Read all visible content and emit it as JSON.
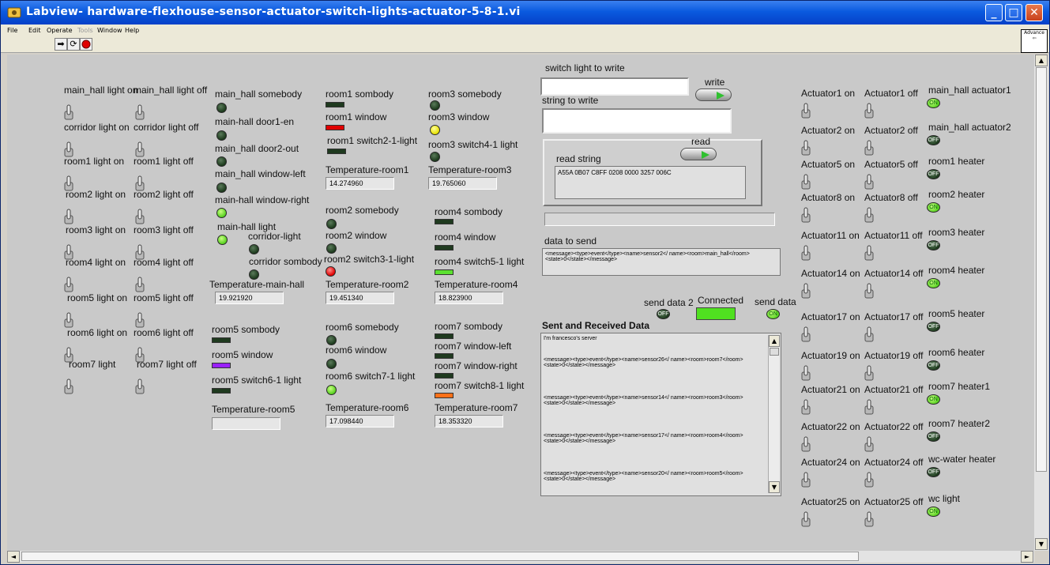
{
  "window": {
    "title": "Labview- hardware-flexhouse-sensor-actuator-switch-lights-actuator-5-8-1.vi"
  },
  "menu": [
    "File",
    "Edit",
    "Operate",
    "Tools",
    "Window",
    "Help"
  ],
  "advanced_label": "Advance",
  "left_switches": [
    [
      "main_hall light on",
      "main_hall light off"
    ],
    [
      "corridor light on",
      "corridor light off"
    ],
    [
      "room1 light on",
      "room1 light off"
    ],
    [
      "room2 light on",
      "room2 light off"
    ],
    [
      "room3 light on",
      "room3 light off"
    ],
    [
      "room4 light on",
      "room4 light off"
    ],
    [
      "room5 light on",
      "room5 light off"
    ],
    [
      "room6 light on",
      "room6 light off"
    ],
    [
      "room7 light",
      "room7 light off"
    ]
  ],
  "mainhall": {
    "somebody": "main_hall somebody",
    "door1": "main-hall door1-en",
    "door2": "main_hall door2-out",
    "window_left": "main_hall window-left",
    "window_right": "main-hall window-right",
    "light": "main-hall light",
    "corridor_light": "corridor-light",
    "corridor_somebody": "corridor sombody",
    "temp_label": "Temperature-main-hall",
    "temp": "19.921920"
  },
  "room1": {
    "somebody": "room1 sombody",
    "window": "room1 window",
    "switch": "room1 switch2-1-light",
    "temp_label": "Temperature-room1",
    "temp": "14.274960"
  },
  "room3": {
    "somebody": "room3 somebody",
    "window": "room3 window",
    "switch": "room3 switch4-1 light",
    "temp_label": "Temperature-room3",
    "temp": "19.765060"
  },
  "room2": {
    "somebody": "room2 somebody",
    "window": "room2 window",
    "switch": "room2 switch3-1-light",
    "temp_label": "Temperature-room2",
    "temp": "19.451340"
  },
  "room4": {
    "somebody": "room4 sombody",
    "window": "room4 window",
    "switch": "room4 switch5-1 light",
    "temp_label": "Temperature-room4",
    "temp": "18.823900"
  },
  "room5": {
    "somebody": "room5 sombody",
    "window": "room5 window",
    "switch": "room5 switch6-1 light",
    "temp_label": "Temperature-room5",
    "temp": ""
  },
  "room6": {
    "somebody": "room6 somebody",
    "window": "room6 window",
    "switch": "room6 switch7-1 light",
    "temp_label": "Temperature-room6",
    "temp": "17.098440"
  },
  "room7": {
    "somebody": "room7 sombody",
    "window_left": "room7 window-left",
    "window_right": "room7 window-right",
    "switch": "room7 switch8-1 light",
    "temp_label": "Temperature-room7",
    "temp": "18.353320"
  },
  "comm": {
    "switch_light_label": "switch light to write",
    "switch_light_value": "",
    "write_label": "write",
    "string_label": "string to write",
    "string_value": "",
    "read_label": "read",
    "read_string_label": "read string",
    "read_string_value": "A55A 0B07 C8FF 0208 0000 3257 006C",
    "data_to_send_label": "data to send",
    "data_to_send_value": "<message><type>event</type><name>sensor2</ name><room>main_hall</room><state>0</state></message>",
    "send_data2_label": "send data 2",
    "connected_label": "Connected",
    "send_data_label": "send data",
    "off_text": "OFF",
    "on_text": "ON",
    "sent_received_label": "Sent and Received Data",
    "log": [
      "I'm francesco's server",
      "<message><type>event</type><name>sensor26</ name><room>room7</room><state>0</state></message>",
      "<message><type>event</type><name>sensor14</ name><room>room3</room><state>0</state></message>",
      "<message><type>event</type><name>sensor17</ name><room>room4</room><state>0</state></message>",
      "<message><type>event</type><name>sensor20</ name><room>room5</room><state>0</state></message>"
    ]
  },
  "actuators": [
    {
      "on": "Actuator1 on",
      "off": "Actuator1 off",
      "name": "main_hall actuator1",
      "state": "ON"
    },
    {
      "on": "Actuator2 on",
      "off": "Actuator2 off",
      "name": "main_hall actuator2",
      "state": "OFF"
    },
    {
      "on": "Actuator5 on",
      "off": "Actuator5 off",
      "name": "room1 heater",
      "state": "OFF"
    },
    {
      "on": "Actuator8 on",
      "off": "Actuator8 off",
      "name": "room2 heater",
      "state": "ON"
    },
    {
      "on": "Actuator11 on",
      "off": "Actuator11 off",
      "name": "room3 heater",
      "state": "OFF"
    },
    {
      "on": "Actuator14 on",
      "off": "Actuator14 off",
      "name": "room4 heater",
      "state": "ON"
    },
    {
      "on": "Actuator17 on",
      "off": "Actuator17 off",
      "name": "room5 heater",
      "state": "OFF"
    },
    {
      "on": "Actuator19 on",
      "off": "Actuator19 off",
      "name": "room6 heater",
      "state": "OFF"
    },
    {
      "on": "Actuator21 on",
      "off": "Actuator21 off",
      "name": "room7 heater1",
      "state": "ON"
    },
    {
      "on": "Actuator22 on",
      "off": "Actuator22 off",
      "name": "room7 heater2",
      "state": "OFF"
    },
    {
      "on": "Actuator24 on",
      "off": "Actuator24 off",
      "name": "wc-water heater",
      "state": "OFF"
    },
    {
      "on": "Actuator25 on",
      "off": "Actuator25 off",
      "name": "wc light",
      "state": "ON"
    }
  ]
}
